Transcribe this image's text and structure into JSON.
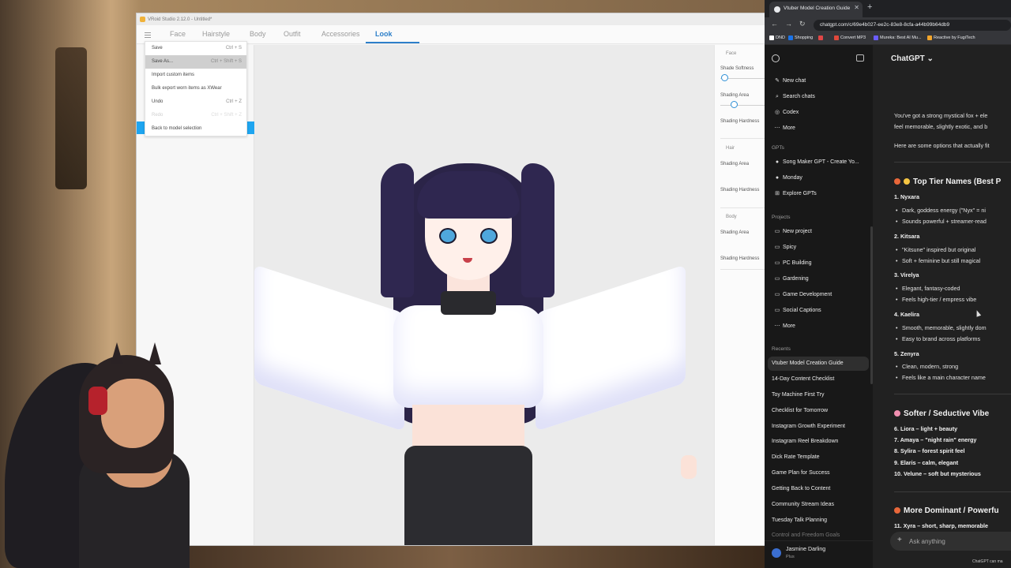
{
  "vroid": {
    "window_title": "VRoid Studio 2.12.0 - Untitled*",
    "tabs": [
      {
        "label": "Face"
      },
      {
        "label": "Hairstyle"
      },
      {
        "label": "Body"
      },
      {
        "label": "Outfit"
      },
      {
        "label": "Accessories"
      },
      {
        "label": "Look"
      }
    ],
    "active_tab": "Look",
    "menu": [
      {
        "label": "Save",
        "shortcut": "Ctrl + S"
      },
      {
        "label": "Save As...",
        "shortcut": "Ctrl + Shift + S"
      },
      {
        "label": "Import custom items",
        "shortcut": ""
      },
      {
        "label": "Bulk export worn items as XWear",
        "shortcut": ""
      },
      {
        "label": "Undo",
        "shortcut": "Ctrl + Z"
      },
      {
        "label": "Redo",
        "shortcut": "Ctrl + Shift + Z"
      },
      {
        "label": "Back to model selection",
        "shortcut": ""
      }
    ],
    "right_panel": {
      "face_section": "Face",
      "shade_softness": "Shade Softness",
      "shading_area": "Shading Area",
      "shading_hardness": "Shading Hardness",
      "hair_section": "Hair",
      "hair_shading_area": "Shading Area",
      "hair_shading_hardness": "Shading Hardness",
      "body_section": "Body",
      "body_shading_area": "Shading Area",
      "body_shading_hardness": "Shading Hardness"
    }
  },
  "chrome": {
    "tab_title": "Vtuber Model Creation Guide",
    "url": "chatgpt.com/c/69e4b027-ee2c-83e8-8cfa-a44b99b64db9",
    "bookmarks": [
      {
        "label": "DND",
        "color": "#ffffff"
      },
      {
        "label": "Shopping",
        "color": "#1a73e8"
      },
      {
        "label": "",
        "color": "#e04646"
      },
      {
        "label": "Convert MP3",
        "color": "#e0483b"
      },
      {
        "label": "Mureka: Best AI Mu...",
        "color": "#6a5cff"
      },
      {
        "label": "Reactive by FugiTech",
        "color": "#f2a52b"
      }
    ]
  },
  "chatgpt": {
    "sidebar": {
      "new_chat": "New chat",
      "search_chats": "Search chats",
      "codex": "Codex",
      "more": "More",
      "gpts_heading": "GPTs",
      "gpts": [
        {
          "label": "Song Maker GPT - Create Yo..."
        },
        {
          "label": "Monday"
        },
        {
          "label": "Explore GPTs"
        }
      ],
      "projects_heading": "Projects",
      "projects": [
        {
          "label": "New project"
        },
        {
          "label": "Spicy"
        },
        {
          "label": "PC Building"
        },
        {
          "label": "Gardening"
        },
        {
          "label": "Game Development"
        },
        {
          "label": "Social Captions"
        },
        {
          "label": "More"
        }
      ],
      "recents_heading": "Recents",
      "recents": [
        {
          "label": "Vtuber Model Creation Guide"
        },
        {
          "label": "14-Day Content Checklist"
        },
        {
          "label": "Toy Machine First Try"
        },
        {
          "label": "Checklist for Tomorrow"
        },
        {
          "label": "Instagram Growth Experiment"
        },
        {
          "label": "Instagram Reel Breakdown"
        },
        {
          "label": "Dick Rate Template"
        },
        {
          "label": "Game Plan for Success"
        },
        {
          "label": "Getting Back to Content"
        },
        {
          "label": "Community Stream Ideas"
        },
        {
          "label": "Tuesday Talk Planning"
        },
        {
          "label": "Control and Freedom Goals"
        }
      ],
      "user_name": "Jasmine Darling",
      "user_plan": "Plus"
    },
    "model_label": "ChatGPT ⌄",
    "message": {
      "intro_line1": "You've got a strong mystical fox + ele",
      "intro_line2": "feel memorable, slightly exotic, and b",
      "intro_line3": "Here are some options that actually fit",
      "section1": "Top Tier Names (Best P",
      "names1": [
        {
          "n": "1. Nyxara",
          "b": [
            "Dark, goddess energy (\"Nyx\" = ni",
            "Sounds powerful + streamer-read"
          ]
        },
        {
          "n": "2. Kitsara",
          "b": [
            "\"Kitsune\" inspired but original",
            "Soft + feminine but still magical"
          ]
        },
        {
          "n": "3. Virelya",
          "b": [
            "Elegant, fantasy-coded",
            "Feels high-tier / empress vibe"
          ]
        },
        {
          "n": "4. Kaelira",
          "b": [
            "Smooth, memorable, slightly dom",
            "Easy to brand across platforms"
          ]
        },
        {
          "n": "5. Zenyra",
          "b": [
            "Clean, modern, strong",
            "Feels like a main character name"
          ]
        }
      ],
      "section2": "Softer / Seductive Vibe",
      "names2": [
        "6. Liora – light + beauty",
        "7. Amaya – \"night rain\" energy",
        "8. Sylira – forest spirit feel",
        "9. Elaris – calm, elegant",
        "10. Velune – soft but mysterious"
      ],
      "section3": "More Dominant / Powerfu",
      "names3": [
        "11. Xyra – short, sharp, memorable"
      ]
    },
    "composer_placeholder": "Ask anything",
    "footer": "ChatGPT can ma",
    "colors": {
      "accent_blue": "#2d7fc9",
      "sidebar_bg": "#181818",
      "main_bg": "#212121"
    }
  }
}
